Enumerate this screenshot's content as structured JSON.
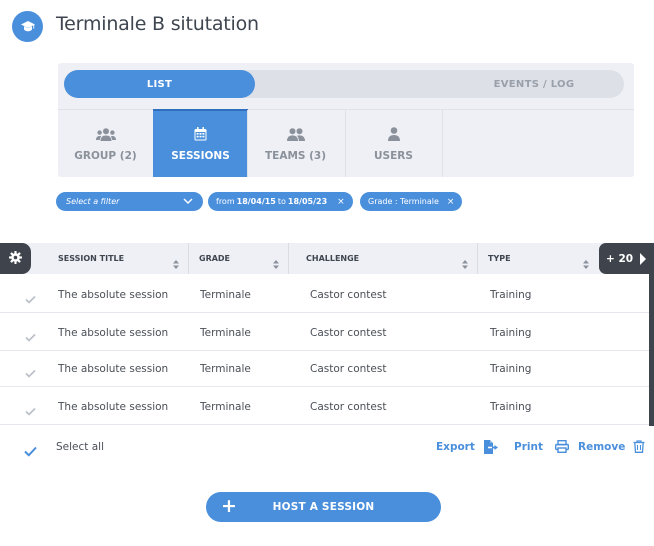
{
  "header": {
    "title": "Terminale B situtation",
    "icon": "graduation-cap-icon"
  },
  "view_toggle": {
    "list_label": "LIST",
    "events_label": "EVENTS / LOG",
    "active": "list"
  },
  "tabs": [
    {
      "label": "GROUP (2)",
      "icon": "users-group-icon",
      "active": false
    },
    {
      "label": "SESSIONS",
      "icon": "calendar-icon",
      "active": true
    },
    {
      "label": "TEAMS (3)",
      "icon": "team-icon",
      "active": false
    },
    {
      "label": "USERS",
      "icon": "user-icon",
      "active": false
    }
  ],
  "filters": {
    "select_placeholder": "Select a filter",
    "date_chip": {
      "prefix": "from",
      "from": "18/04/15",
      "middle": "to",
      "to": "18/05/23",
      "remove": "×"
    },
    "grade_chip": {
      "label": "Grade : Terminale",
      "remove": "×"
    }
  },
  "table": {
    "columns": [
      "SESSION TITLE",
      "GRADE",
      "CHALLENGE",
      "TYPE"
    ],
    "more_label": "+ 20",
    "rows": [
      [
        "The absolute session",
        "Terminale",
        "Castor contest",
        "Training"
      ],
      [
        "The absolute session",
        "Terminale",
        "Castor contest",
        "Training"
      ],
      [
        "The absolute session",
        "Terminale",
        "Castor contest",
        "Training"
      ],
      [
        "The absolute session",
        "Terminale",
        "Castor contest",
        "Training"
      ]
    ]
  },
  "footer": {
    "select_all": "Select all",
    "export_label": "Export",
    "print_label": "Print",
    "remove_label": "Remove"
  },
  "host_button": {
    "plus": "+",
    "label": "HOST A SESSION"
  },
  "colors": {
    "accent": "#4a8fdc",
    "dark": "#3f444c",
    "panel": "#eef0f5"
  }
}
